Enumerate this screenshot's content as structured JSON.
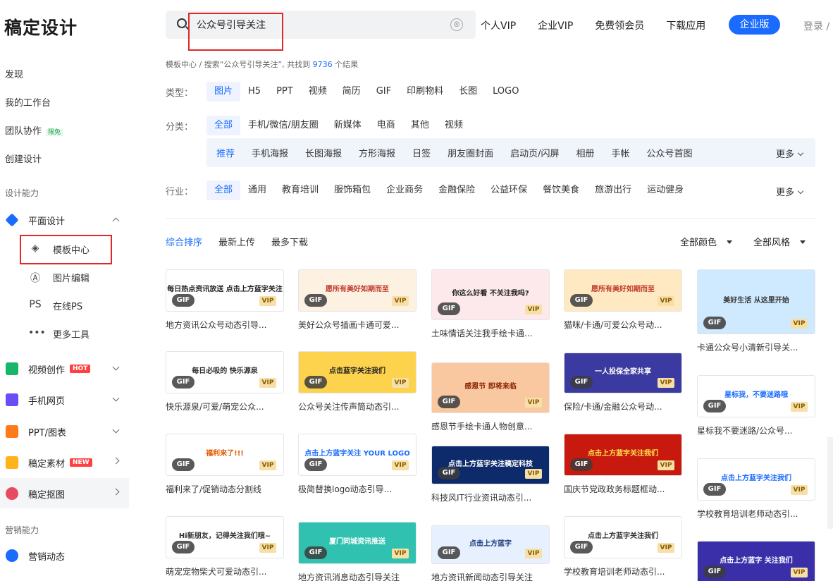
{
  "brand": "稿定设计",
  "search": {
    "value": "公众号引导关注",
    "clear": "⊗"
  },
  "topnav": [
    "个人VIP",
    "企业VIP",
    "免费领会员",
    "下载应用"
  ],
  "enterprise_btn": "企业版",
  "login": "登录 /",
  "sidebar": {
    "top_items": [
      "发现",
      "我的工作台",
      "团队协作",
      "创建设计"
    ],
    "team_badge": "限免",
    "section_design": "设计能力",
    "menus": [
      {
        "label": "平面设计"
      },
      {
        "label": "视频创作",
        "badge": "HOT"
      },
      {
        "label": "手机网页"
      },
      {
        "label": "PPT/图表"
      },
      {
        "label": "稿定素材",
        "badge": "NEW"
      },
      {
        "label": "稿定抠图"
      }
    ],
    "sub_items": [
      {
        "icon": "◈",
        "label": "模板中心"
      },
      {
        "icon": "Ⓐ",
        "label": "图片编辑"
      },
      {
        "icon": "PS",
        "label": "在线PS"
      },
      {
        "icon": "•••",
        "label": "更多工具"
      }
    ],
    "section_marketing": "营销能力",
    "marketing_item": "营销动态"
  },
  "breadcrumb": {
    "home": "模板中心",
    "sep": "/",
    "prefix": "搜索“公众号引导关注”, 共找到",
    "count": "9736",
    "suffix": "个结果"
  },
  "filters": {
    "type_label": "类型：",
    "types": [
      "图片",
      "H5",
      "PPT",
      "视频",
      "简历",
      "GIF",
      "印刷物料",
      "长图",
      "LOGO"
    ],
    "cat_label": "分类：",
    "cats": [
      "全部",
      "手机/微信/朋友圈",
      "新媒体",
      "电商",
      "其他",
      "视频"
    ],
    "subcats": [
      "推荐",
      "手机海报",
      "长图海报",
      "方形海报",
      "日签",
      "朋友圈封面",
      "启动页/闪屏",
      "相册",
      "手帐",
      "公众号首图"
    ],
    "more": "更多",
    "ind_label": "行业：",
    "industries": [
      "全部",
      "通用",
      "教育培训",
      "服饰箱包",
      "企业商务",
      "金融保险",
      "公益环保",
      "餐饮美食",
      "旅游出行",
      "运动健身"
    ]
  },
  "sort": [
    "综合排序",
    "最新上传",
    "最多下载"
  ],
  "color_dd": "全部颜色",
  "style_dd": "全部风格",
  "tags": {
    "gif": "GIF",
    "vip": "VIP"
  },
  "cards": [
    {
      "cap": "地方资讯公众号动态引导...",
      "txt": "每日热点资讯放送 点击上方蓝字关注"
    },
    {
      "cap": "美好公众号插画卡通可爱...",
      "txt": "愿所有美好如期而至"
    },
    {
      "cap": "土味情话关注我手绘卡通...",
      "txt": "你这么好看 不关注我吗?"
    },
    {
      "cap": "猫咪/卡通/可爱公众号动...",
      "txt": "愿所有美好如期而至"
    },
    {
      "cap": "卡通公众号小清新引导关...",
      "txt": "美好生活 从这里开始"
    },
    {
      "cap": "快乐源泉/可爱/萌宠公众...",
      "txt": "每日必吸的 快乐源泉"
    },
    {
      "cap": "公众号关注传声筒动态引...",
      "txt": "点击蓝字关注我们"
    },
    {
      "cap": "感恩节手绘卡通人物创意...",
      "txt": "感恩节 即将来临"
    },
    {
      "cap": "保险/卡通/金融公众号动...",
      "txt": "一人投保全家共享"
    },
    {
      "cap": "星标我不要迷路/公众号...",
      "txt": "星标我，不要迷路哦"
    },
    {
      "cap": "福利来了/促销动态分割线",
      "txt": "福利来了!!!"
    },
    {
      "cap": "极简替换logo动态引导...",
      "txt": "点击上方蓝字关注 YOUR LOGO"
    },
    {
      "cap": "科技风IT行业资讯动态引...",
      "txt": "点击上方蓝字关注稿定科技"
    },
    {
      "cap": "国庆节党政政务标题框动...",
      "txt": "点击上方蓝字关注我们"
    },
    {
      "cap": "学校教育培训老师动态引...",
      "txt": "点击上方蓝字关注我们"
    },
    {
      "cap": "萌宠宠物柴犬可爱动态引...",
      "txt": "Hi新朋友，记得关注我们哦~"
    },
    {
      "cap": "地方资讯消息动态引导关注",
      "txt": "厦门同城资讯推送"
    },
    {
      "cap": "地方资讯新闻动态引导关注",
      "txt": "点击上方蓝字"
    },
    {
      "cap": "学校教育培训老师动态引...",
      "txt": "点击上方蓝字关注我们"
    },
    {
      "cap": "",
      "txt": "点击上方蓝字 关注我们"
    }
  ],
  "colors": {
    "accent": "#1a6cff",
    "highlight": "#e02828",
    "hot": "#ff4040"
  }
}
